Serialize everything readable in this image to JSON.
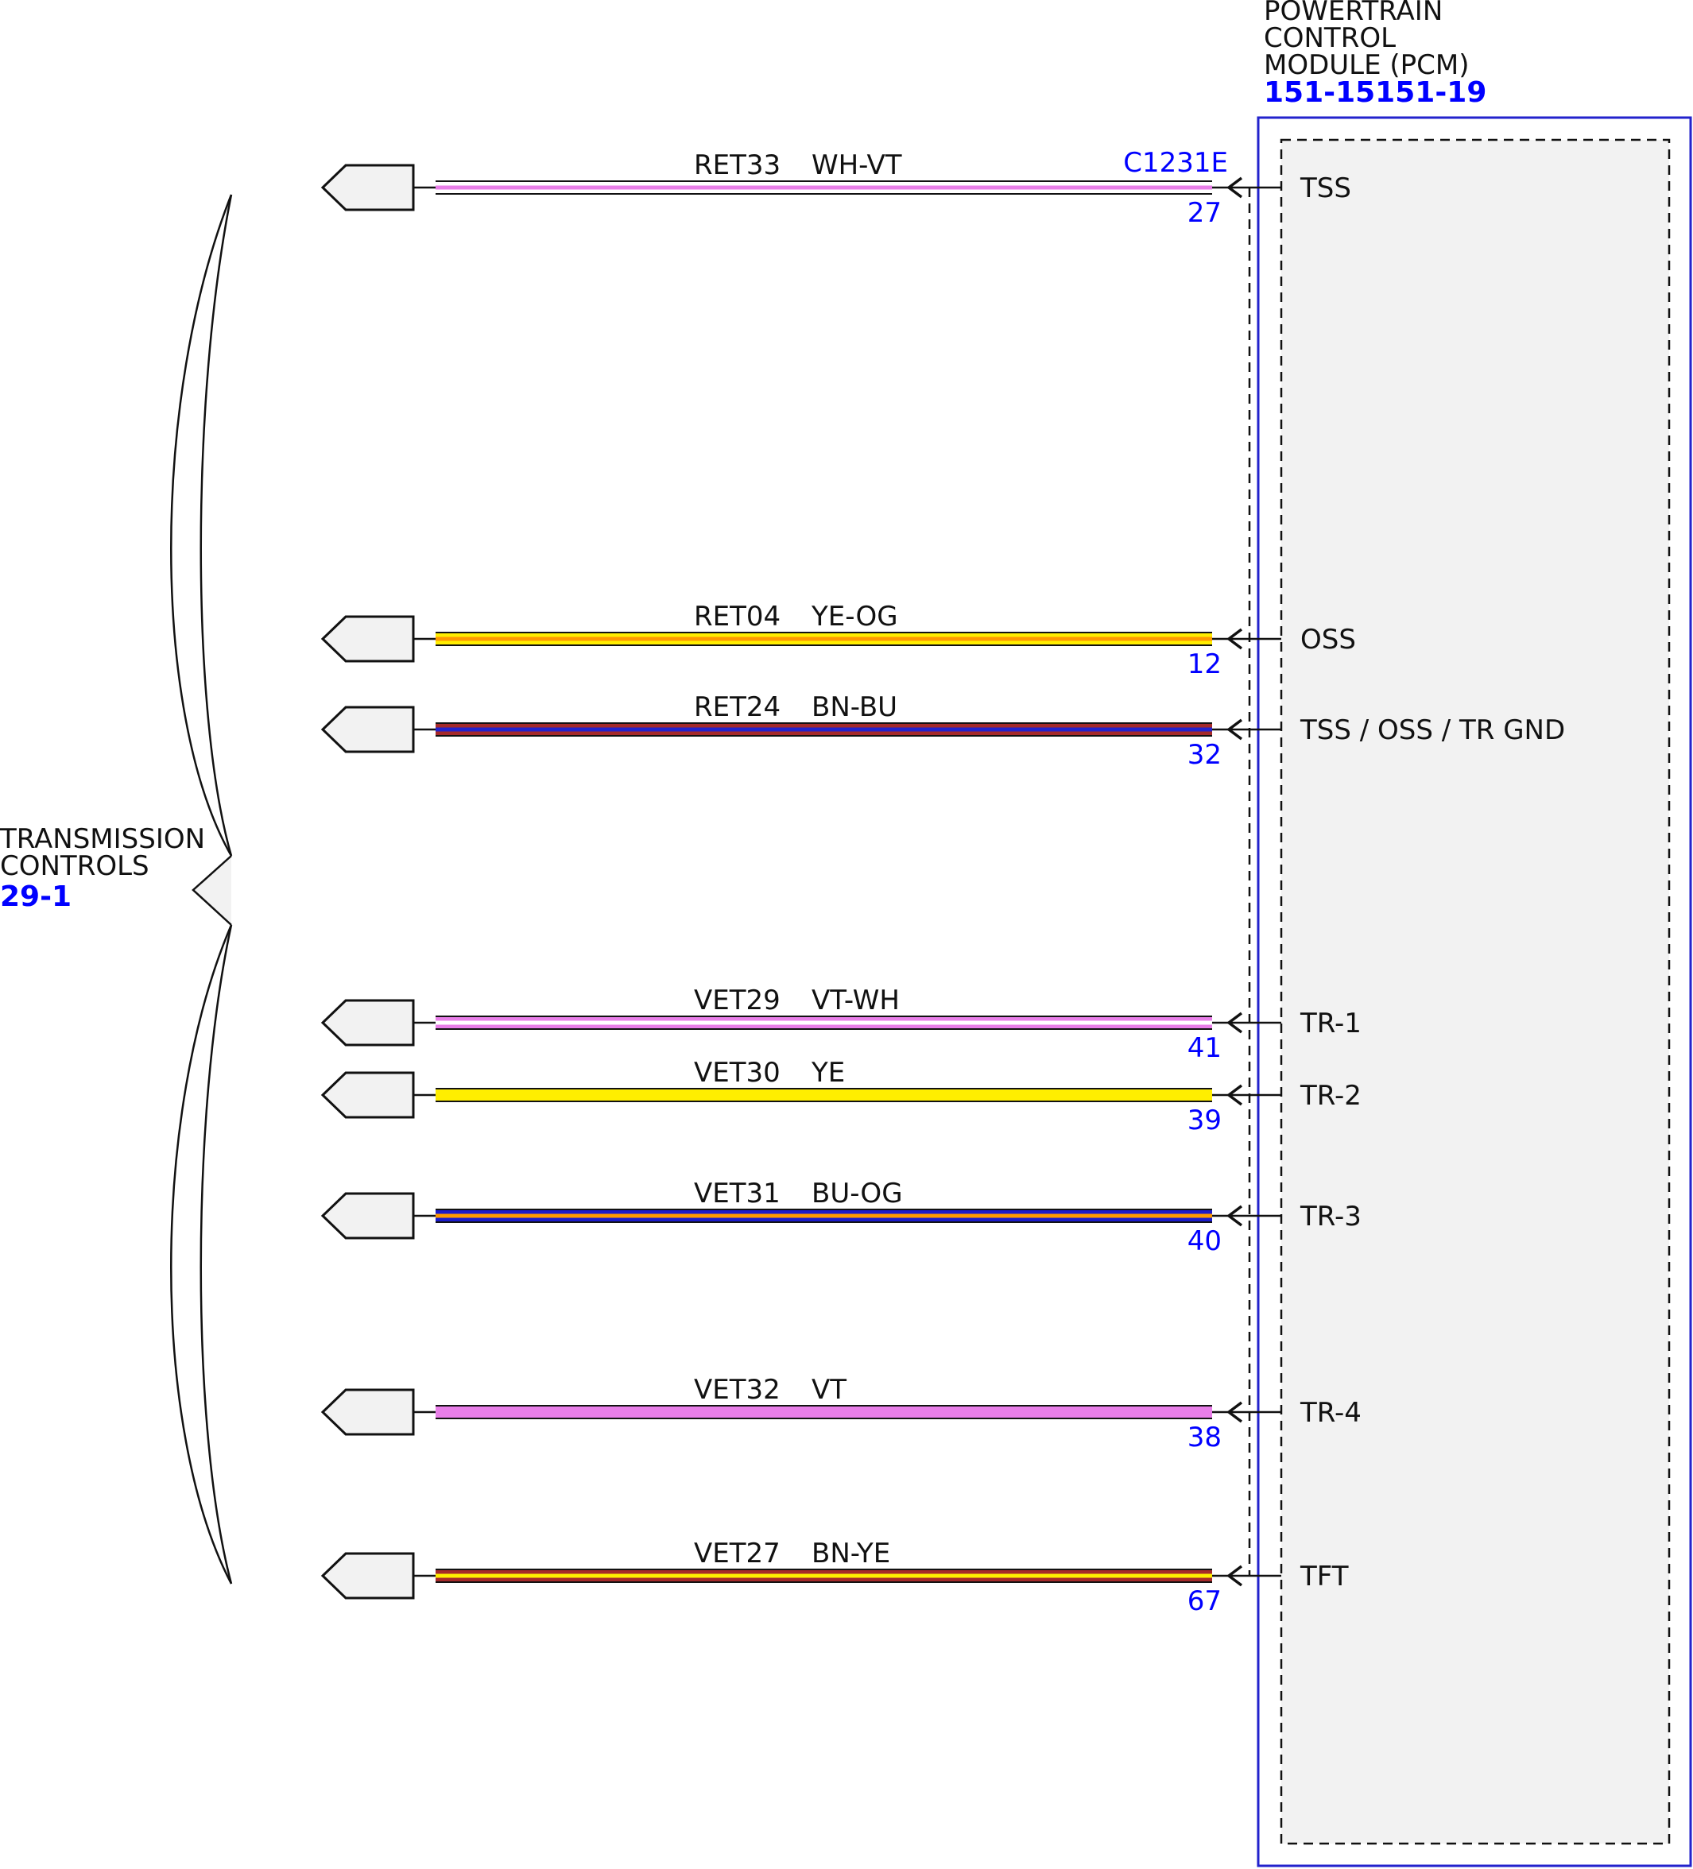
{
  "module": {
    "title_lines": [
      "POWERTRAIN",
      "CONTROL",
      "MODULE (PCM)"
    ],
    "ref": "151-15151-19",
    "connector": "C1231E"
  },
  "group": {
    "title_lines": [
      "TRANSMISSION",
      "CONTROLS"
    ],
    "ref": "29-1"
  },
  "colors": {
    "ref_blue": "#0000ff",
    "module_border": "#2222cc",
    "module_fill": "#f2f2f2"
  },
  "wires": [
    {
      "circuit": "RET33",
      "color_code": "WH-VT",
      "pin": "27",
      "signal": "TSS",
      "colors": [
        "#ffffff",
        "#e87ee8"
      ]
    },
    {
      "circuit": "RET04",
      "color_code": "YE-OG",
      "pin": "12",
      "signal": "OSS",
      "colors": [
        "#ffee00",
        "#ff9900"
      ]
    },
    {
      "circuit": "RET24",
      "color_code": "BN-BU",
      "pin": "32",
      "signal": "TSS / OSS / TR GND",
      "colors": [
        "#a52a2a",
        "#2222cc"
      ]
    },
    {
      "circuit": "VET29",
      "color_code": "VT-WH",
      "pin": "41",
      "signal": "TR-1",
      "colors": [
        "#e87ee8",
        "#ffffff"
      ]
    },
    {
      "circuit": "VET30",
      "color_code": "YE",
      "pin": "39",
      "signal": "TR-2",
      "colors": [
        "#ffee00",
        "#ffee00"
      ]
    },
    {
      "circuit": "VET31",
      "color_code": "BU-OG",
      "pin": "40",
      "signal": "TR-3",
      "colors": [
        "#1a1acc",
        "#ff9900"
      ]
    },
    {
      "circuit": "VET32",
      "color_code": "VT",
      "pin": "38",
      "signal": "TR-4",
      "colors": [
        "#e87ee8",
        "#e87ee8"
      ]
    },
    {
      "circuit": "VET27",
      "color_code": "BN-YE",
      "pin": "67",
      "signal": "TFT",
      "colors": [
        "#a52a2a",
        "#ffee00"
      ]
    }
  ]
}
